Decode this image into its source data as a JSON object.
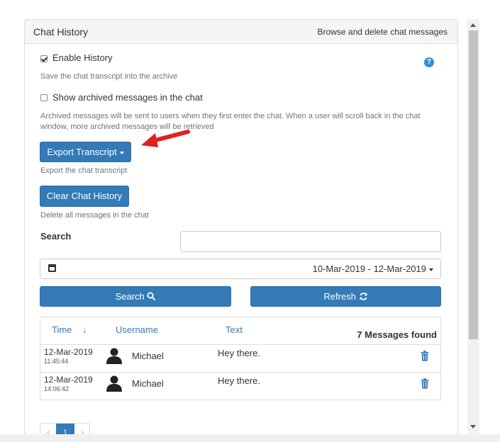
{
  "panel": {
    "title": "Chat History",
    "subtitle": "Browse and delete chat messages"
  },
  "history": {
    "enable_label": "Enable History",
    "enable_checked": true,
    "enable_help": "Save the chat transcript into the archive",
    "show_archived_label": "Show archived messages in the chat",
    "show_archived_checked": false,
    "show_archived_help": "Archived messages will be sent to users when they first enter the chat. When a user will scroll back in the chat window, more archived messages will be retrieved",
    "help_icon_glyph": "?"
  },
  "export": {
    "button_label": "Export Transcript",
    "help": "Export the chat transcript"
  },
  "clear": {
    "button_label": "Clear Chat History",
    "help": "Delete all messages in the chat"
  },
  "search": {
    "label": "Search",
    "value": "",
    "placeholder": "",
    "date_range": "10-Mar-2019 - 12-Mar-2019",
    "search_button": "Search",
    "refresh_button": "Refresh"
  },
  "table": {
    "columns": [
      "Time",
      "Username",
      "Text"
    ],
    "sort_glyph": "↓",
    "found": "7 Messages found",
    "rows": [
      {
        "date": "12-Mar-2019",
        "time": "11:45:44",
        "username": "Michael",
        "text": "Hey there."
      },
      {
        "date": "12-Mar-2019",
        "time": "14:06:42",
        "username": "Michael",
        "text": "Hey there."
      }
    ]
  },
  "pagination": {
    "prev": "‹",
    "current": "1",
    "next": "›"
  },
  "colors": {
    "primary": "#337ab7",
    "annotation_arrow": "#e02020"
  }
}
